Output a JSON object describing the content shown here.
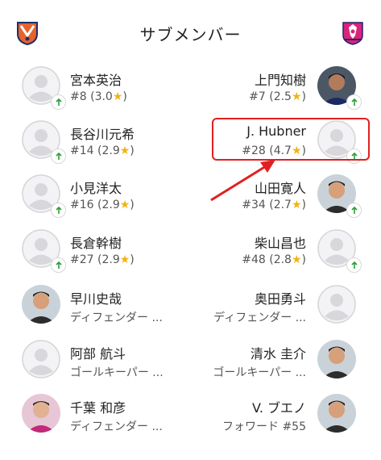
{
  "header": {
    "title": "サブメンバー",
    "left_team": "home-club-emblem",
    "right_team": "away-club-emblem"
  },
  "rows": [
    {
      "left": {
        "name": "宮本英治",
        "number": "#8",
        "rating": "3.0",
        "role": "",
        "avatar": "placeholder",
        "badge": "substitution-in"
      },
      "right": {
        "name": "上門知樹",
        "number": "#7",
        "rating": "2.5",
        "role": "",
        "avatar": "photo",
        "badge": "substitution-in"
      }
    },
    {
      "left": {
        "name": "長谷川元希",
        "number": "#14",
        "rating": "2.9",
        "role": "",
        "avatar": "placeholder",
        "badge": "substitution-in"
      },
      "right": {
        "name": "J. Hubner",
        "number": "#28",
        "rating": "4.7",
        "role": "",
        "avatar": "placeholder",
        "badge": "substitution-in"
      }
    },
    {
      "left": {
        "name": "小見洋太",
        "number": "#16",
        "rating": "2.9",
        "role": "",
        "avatar": "placeholder",
        "badge": "substitution-in"
      },
      "right": {
        "name": "山田寛人",
        "number": "#34",
        "rating": "2.7",
        "role": "",
        "avatar": "photo",
        "badge": "substitution-in"
      }
    },
    {
      "left": {
        "name": "長倉幹樹",
        "number": "#27",
        "rating": "2.9",
        "role": "",
        "avatar": "placeholder",
        "badge": "substitution-in"
      },
      "right": {
        "name": "柴山昌也",
        "number": "#48",
        "rating": "2.8",
        "role": "",
        "avatar": "placeholder",
        "badge": "substitution-in"
      }
    },
    {
      "left": {
        "name": "早川史哉",
        "number": "",
        "rating": "",
        "role": "ディフェンダー ...",
        "avatar": "photo"
      },
      "right": {
        "name": "奥田勇斗",
        "number": "",
        "rating": "",
        "role": "ディフェンダー ...",
        "avatar": "placeholder"
      }
    },
    {
      "left": {
        "name": "阿部 航斗",
        "number": "",
        "rating": "",
        "role": "ゴールキーパー ...",
        "avatar": "placeholder"
      },
      "right": {
        "name": "清水 圭介",
        "number": "",
        "rating": "",
        "role": "ゴールキーパー ...",
        "avatar": "photo"
      }
    },
    {
      "left": {
        "name": "千葉 和彦",
        "number": "",
        "rating": "",
        "role": "ディフェンダー ...",
        "avatar": "photo"
      },
      "right": {
        "name": "V. ブエノ",
        "number": "",
        "rating": "",
        "role": "フォワード #55",
        "avatar": "photo"
      }
    }
  ],
  "annotation": {
    "highlight": "J. Hubner",
    "pointer": "red-arrow"
  },
  "colors": {
    "star": "#f2b312",
    "badge_arrow": "#2e9d3a",
    "highlight": "#e02020"
  }
}
